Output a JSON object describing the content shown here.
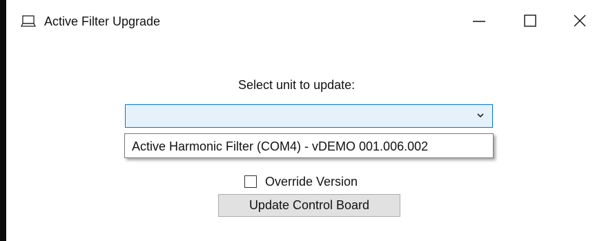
{
  "window": {
    "title": "Active Filter Upgrade",
    "app_icon": "laptop-icon",
    "controls": {
      "minimize_icon": "minimize-icon",
      "maximize_icon": "maximize-icon",
      "close_icon": "close-icon"
    }
  },
  "form": {
    "prompt": "Select unit to update:",
    "unit_select": {
      "selected_value": "",
      "chevron_icon": "chevron-down-icon",
      "options": [
        "Active Harmonic Filter (COM4) - vDEMO 001.006.002"
      ]
    },
    "override_version": {
      "label": "Override Version",
      "checked": false
    },
    "update_button_label": "Update Control Board"
  },
  "colors": {
    "combo_background": "#e5f1fb",
    "combo_border": "#0078d7",
    "button_background": "#e1e1e1"
  }
}
